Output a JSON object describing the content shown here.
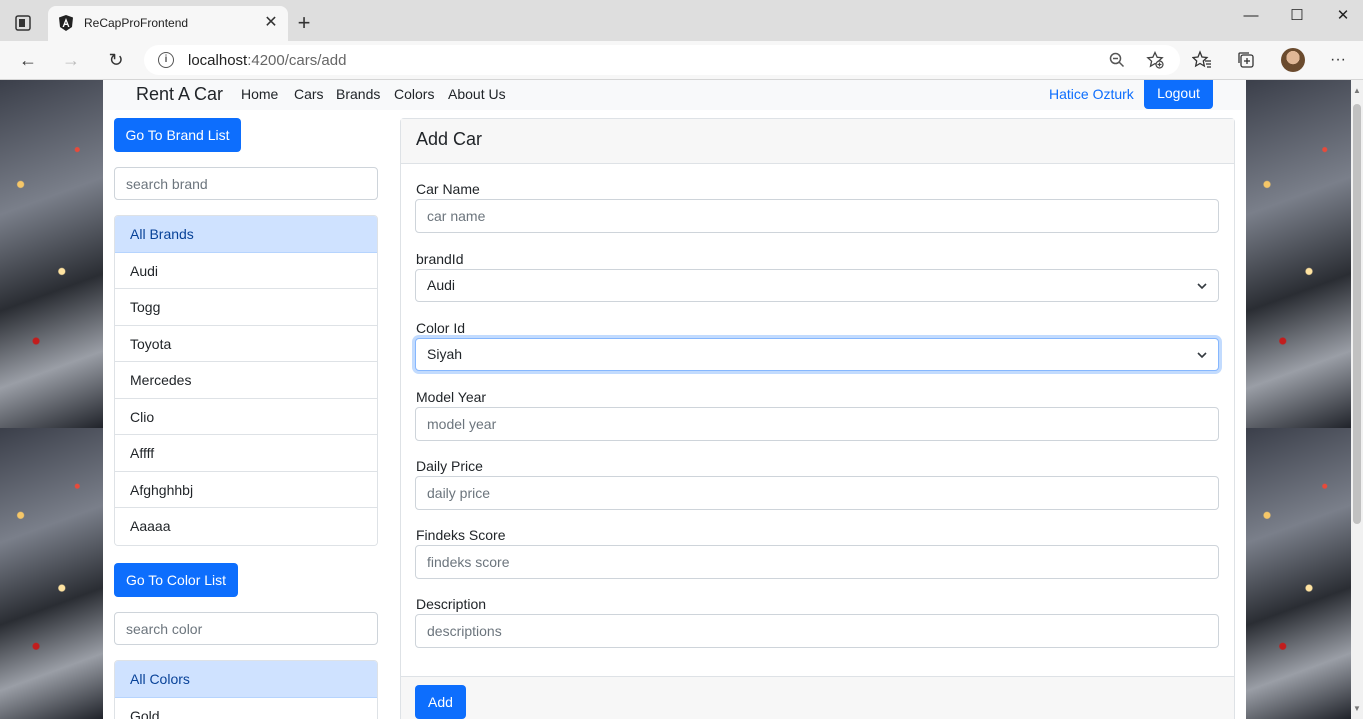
{
  "browser": {
    "tab_title": "ReCapProFrontend",
    "tab_close": "✕",
    "new_tab": "+",
    "url_host": "localhost",
    "url_path": ":4200/cars/add",
    "window_minimize": "—",
    "window_maximize": "☐",
    "window_close": "✕",
    "back": "←",
    "forward": "→",
    "refresh": "↻",
    "more": "···"
  },
  "navbar": {
    "brand": "Rent A Car",
    "links": [
      "Home",
      "Cars",
      "Brands",
      "Colors",
      "About Us"
    ],
    "user": "Hatice Ozturk",
    "logout": "Logout"
  },
  "sidebar": {
    "brand_list_button": "Go To Brand List",
    "brand_search_placeholder": "search brand",
    "brands": [
      "All Brands",
      "Audi",
      "Togg",
      "Toyota",
      "Mercedes",
      "Clio",
      "Affff",
      "Afghghhbj",
      "Aaaaa"
    ],
    "color_list_button": "Go To Color List",
    "color_search_placeholder": "search color",
    "colors": [
      "All Colors",
      "Gold"
    ]
  },
  "form": {
    "title": "Add Car",
    "car_name_label": "Car Name",
    "car_name_placeholder": "car name",
    "brand_label": "brandId",
    "brand_value": "Audi",
    "color_label": "Color Id",
    "color_value": "Siyah",
    "model_year_label": "Model Year",
    "model_year_placeholder": "model year",
    "daily_price_label": "Daily Price",
    "daily_price_placeholder": "daily price",
    "findeks_label": "Findeks Score",
    "findeks_placeholder": "findeks score",
    "description_label": "Description",
    "description_placeholder": "descriptions",
    "submit": "Add"
  },
  "colors": {
    "primary": "#0d6efd",
    "active_list_bg": "#cfe2ff"
  }
}
